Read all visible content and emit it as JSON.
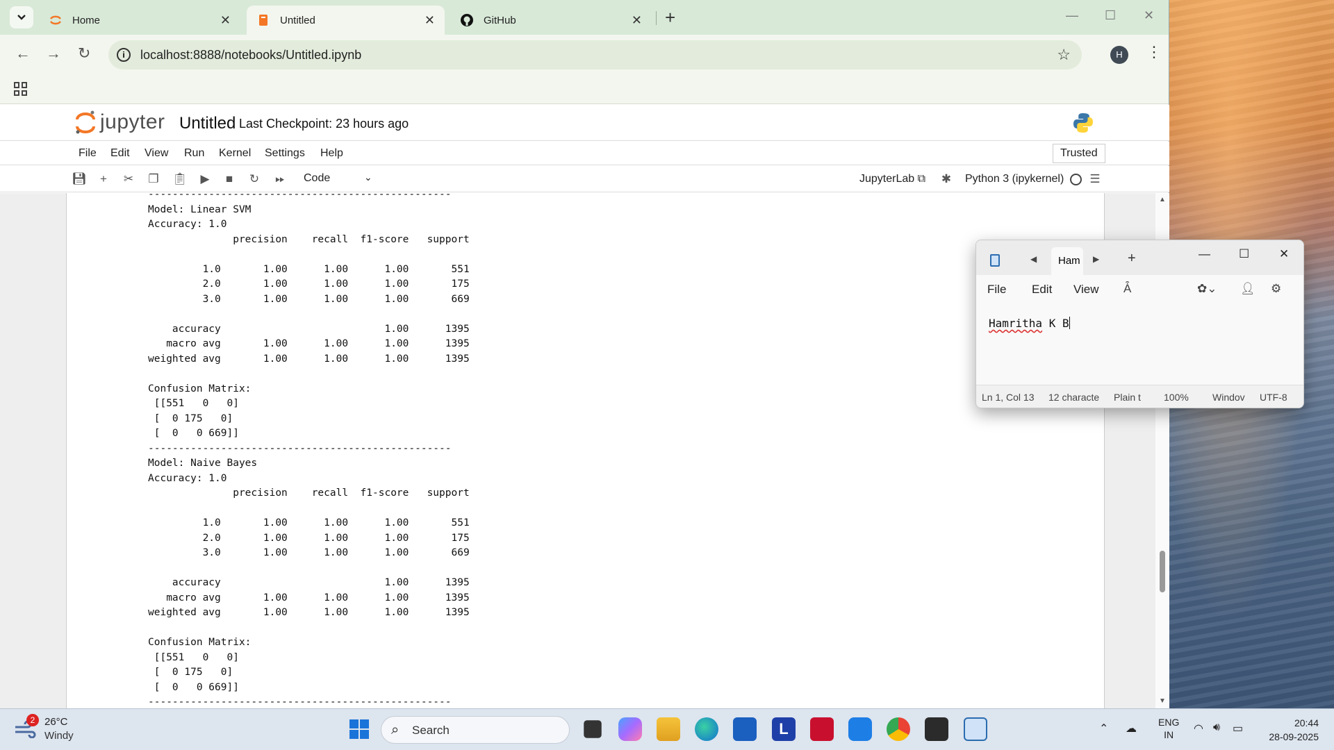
{
  "browser": {
    "tabs": [
      {
        "label": "Home",
        "icon": "jupyter-icon"
      },
      {
        "label": "Untitled",
        "icon": "notebook-icon",
        "active": true
      },
      {
        "label": "GitHub",
        "icon": "github-icon"
      }
    ],
    "url": "localhost:8888/notebooks/Untitled.ipynb",
    "profile_initial": "H"
  },
  "jupyter": {
    "logo_text": "jupyter",
    "notebook_title": "Untitled",
    "checkpoint": "Last Checkpoint: 23 hours ago",
    "menu": [
      "File",
      "Edit",
      "View",
      "Run",
      "Kernel",
      "Settings",
      "Help"
    ],
    "trusted": "Trusted",
    "cell_type": "Code",
    "jupyterlab_link": "JupyterLab",
    "kernel": "Python 3 (ipykernel)"
  },
  "output_text": "--------------------------------------------------\nModel: Linear SVM\nAccuracy: 1.0\n              precision    recall  f1-score   support\n\n         1.0       1.00      1.00      1.00       551\n         2.0       1.00      1.00      1.00       175\n         3.0       1.00      1.00      1.00       669\n\n    accuracy                           1.00      1395\n   macro avg       1.00      1.00      1.00      1395\nweighted avg       1.00      1.00      1.00      1395\n\nConfusion Matrix:\n [[551   0   0]\n [  0 175   0]\n [  0   0 669]]\n--------------------------------------------------\nModel: Naive Bayes\nAccuracy: 1.0\n              precision    recall  f1-score   support\n\n         1.0       1.00      1.00      1.00       551\n         2.0       1.00      1.00      1.00       175\n         3.0       1.00      1.00      1.00       669\n\n    accuracy                           1.00      1395\n   macro avg       1.00      1.00      1.00      1395\nweighted avg       1.00      1.00      1.00      1395\n\nConfusion Matrix:\n [[551   0   0]\n [  0 175   0]\n [  0   0 669]]\n--------------------------------------------------",
  "notepad": {
    "tab_label": "Ham",
    "menu": [
      "File",
      "Edit",
      "View"
    ],
    "text_word1": "Hamritha",
    "text_rest": " K B",
    "status": {
      "position": "Ln 1, Col 13",
      "chars": "12 characte",
      "format": "Plain t",
      "zoom": "100%",
      "line_ending": "Windov",
      "encoding": "UTF-8"
    }
  },
  "taskbar": {
    "weather_badge": "2",
    "weather_temp": "26°C",
    "weather_desc": "Windy",
    "search_label": "Search",
    "lang_line1": "ENG",
    "lang_line2": "IN",
    "time": "20:44",
    "date": "28-09-2025"
  }
}
